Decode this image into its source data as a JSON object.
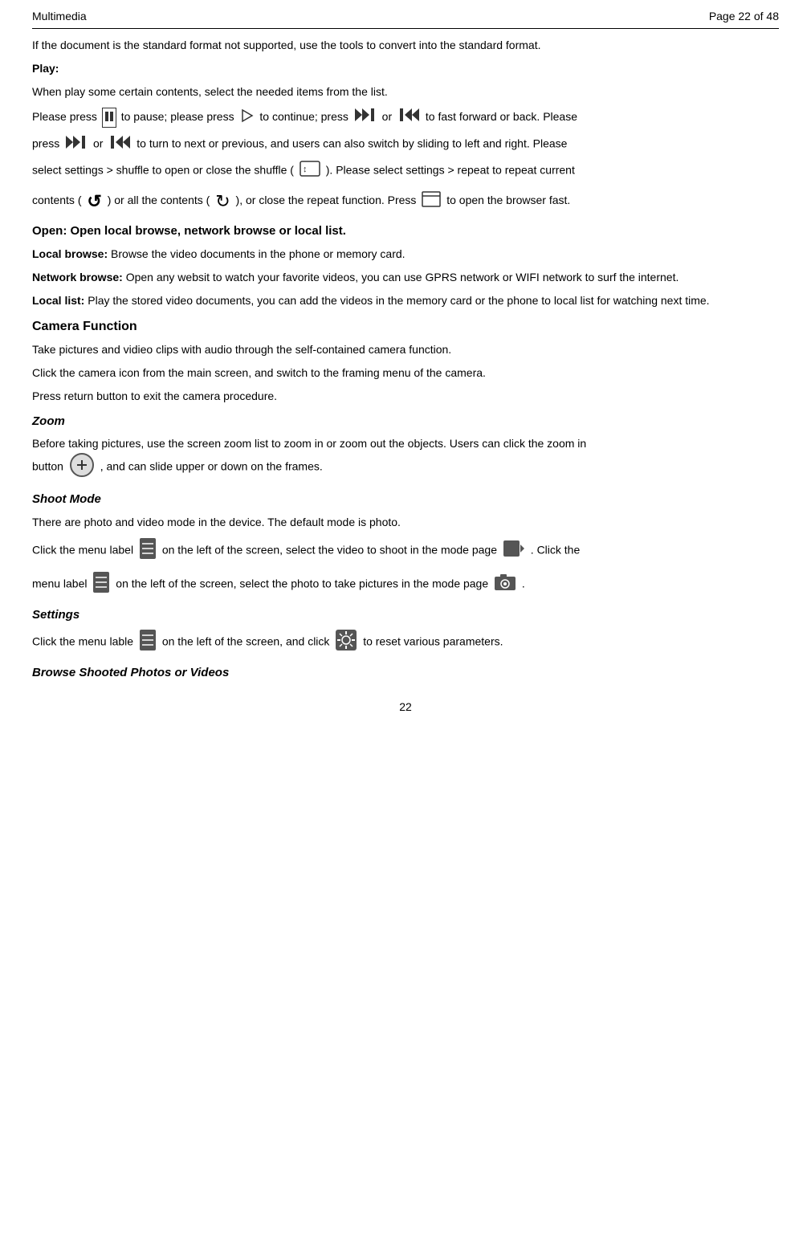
{
  "header": {
    "title": "Multimedia",
    "page_info": "Page 22 of 48"
  },
  "intro": "If the document is the standard format not supported, use the tools to convert into the standard format.",
  "play_section": {
    "heading": "Play:",
    "para1": "When play some certain contents, select the needed items from the list.",
    "para2_pre": "Please press",
    "para2_mid1": "to pause; please press",
    "para2_mid2": "to continue; press",
    "para2_mid3": "or",
    "para2_mid4": "to fast forward or back. Please",
    "para3_pre": "press",
    "para3_mid1": "or",
    "para3_mid2": "to turn to next or previous, and users can also switch by sliding to left and right. Please",
    "para4_pre": "select settings > shuffle to open or close the shuffle (",
    "para4_mid": "). Please select settings > repeat to repeat current",
    "para5_pre": "contents (",
    "para5_mid1": ") or all the contents (",
    "para5_mid2": "), or close the repeat function. Press",
    "para5_end": "to open the browser fast."
  },
  "open_section": {
    "heading": "Open: Open local browse, network browse or local list.",
    "local_browse_label": "Local browse:",
    "local_browse_text": "Browse the video documents in the phone or memory card.",
    "network_browse_label": "Network browse:",
    "network_browse_text": "Open any websit to watch your favorite videos, you can use GPRS network or WIFI network to surf the internet.",
    "local_list_label": "Local list:",
    "local_list_text": "Play the stored video documents, you can add the videos in the memory card or the phone to local list for watching next time."
  },
  "camera_section": {
    "heading": "Camera Function",
    "para1": "Take pictures and vidieo clips with audio through the self-contained camera function.",
    "para2": "Click the camera icon from the main screen, and switch to the framing menu of the camera.",
    "para3": "Press return button to exit the camera procedure."
  },
  "zoom_section": {
    "heading": "Zoom",
    "para1": "Before taking pictures, use the screen zoom list to zoom in or zoom out the objects. Users can click the zoom in",
    "para2": ", and can slide upper or down on the frames."
  },
  "shoot_section": {
    "heading": "Shoot Mode",
    "para1": "There are photo and video mode in the device. The default mode is photo.",
    "para2_pre": "Click the menu label",
    "para2_mid": "on the left of the screen, select the video to shoot in the mode page",
    "para2_end": ". Click the",
    "para3_pre": "menu label",
    "para3_mid": "on the left of the screen, select the photo to take pictures in the mode page",
    "para3_end": "."
  },
  "settings_section": {
    "heading": "Settings",
    "para1_pre": "Click the menu lable",
    "para1_mid": "on the left of the screen, and click",
    "para1_end": "to reset various parameters."
  },
  "browse_section": {
    "heading": "Browse Shooted Photos or Videos"
  },
  "page_number": "22"
}
